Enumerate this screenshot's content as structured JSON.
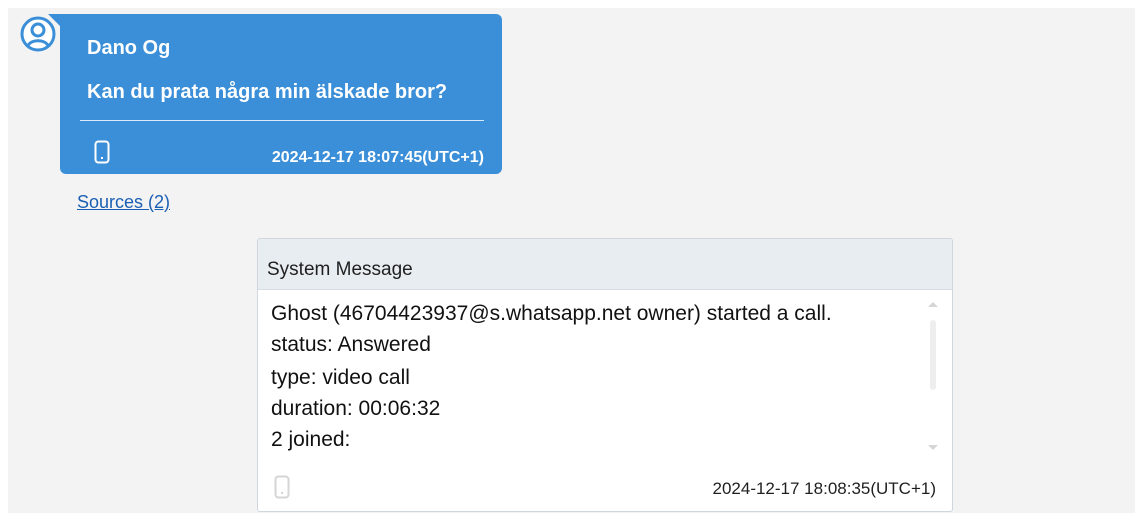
{
  "message": {
    "sender": "Dano Og",
    "text": "Kan du prata några min älskade bror?",
    "timestamp": "2024-12-17 18:07:45(UTC+1)",
    "device_icon": "phone-icon",
    "avatar_icon": "user-avatar-icon",
    "bubble_color": "#3a8fd8"
  },
  "sources_link": "Sources (2)",
  "system_message": {
    "title": "System Message",
    "lines": [
      "Ghost (46704423937@s.whatsapp.net owner) started a call.",
      "status: Answered",
      "type: video call",
      "duration: 00:06:32",
      "2 joined:"
    ],
    "timestamp": "2024-12-17 18:08:35(UTC+1)",
    "device_icon": "phone-icon"
  }
}
